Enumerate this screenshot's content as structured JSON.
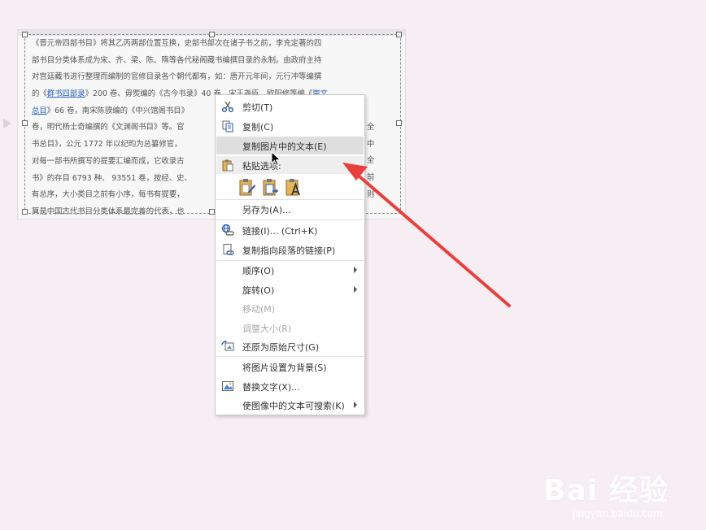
{
  "document": {
    "lines": [
      "《晋元帝四部书目》将其乙丙两部位置互换，史部书部次在诸子书之前，李充定著的四",
      "部书目分类体系成为宋、齐、梁、陈、隋等各代秘阁藏书编撰目录的永制。由政府主持",
      "对宫廷藏书进行整理而编制的官修目录各个朝代都有，如：唐开元年间，元行冲等编撰",
      [
        "的《",
        "群书四部录",
        "》200 卷、毋煚编的《古今书录》40 卷，宋王尧臣、欧阳修等编《",
        "崇文"
      ],
      [
        "",
        "总目",
        "》66 卷，南宋陈骙编的《中兴馆阁书目》"
      ],
      "卷，明代杨士奇编撰的《文渊阁书目》等。官",
      "书总目》，公元 1772 年以纪昀为总纂修官，",
      "对每一部书所撰写的提要汇编而成，它收录古",
      "书》的存目 6793 种、 93551 卷，按经、史、",
      "有总序，大小类目之前有小序，每书有提要，",
      "算是中国古代书目分类体系最完善的代表，也"
    ],
    "right_fragments": [
      "全",
      "中",
      "全",
      "前",
      "则"
    ]
  },
  "context_menu": {
    "items": [
      {
        "label": "剪切(T)",
        "icon": "scissors-icon",
        "disabled": false,
        "submenu": false
      },
      {
        "label": "复制(C)",
        "icon": "copy-icon",
        "disabled": false,
        "submenu": false
      },
      {
        "label": "复制图片中的文本(E)",
        "icon": "",
        "disabled": false,
        "submenu": false
      },
      {
        "label": "粘贴选项:",
        "icon": "paste-icon",
        "disabled": false,
        "submenu": false
      },
      {
        "label": "另存为(A)...",
        "icon": "",
        "disabled": false,
        "submenu": false
      },
      {
        "label": "链接(I)... (Ctrl+K)",
        "icon": "link-icon",
        "disabled": false,
        "submenu": false
      },
      {
        "label": "复制指向段落的链接(P)",
        "icon": "link-paragraph-icon",
        "disabled": false,
        "submenu": false
      },
      {
        "label": "顺序(O)",
        "icon": "",
        "disabled": false,
        "submenu": true
      },
      {
        "label": "旋转(O)",
        "icon": "",
        "disabled": false,
        "submenu": true
      },
      {
        "label": "移动(M)",
        "icon": "",
        "disabled": true,
        "submenu": false
      },
      {
        "label": "调整大小(R)",
        "icon": "",
        "disabled": true,
        "submenu": false
      },
      {
        "label": "还原为原始尺寸(G)",
        "icon": "reset-picture-icon",
        "disabled": false,
        "submenu": false
      },
      {
        "label": "将图片设置为背景(S)",
        "icon": "",
        "disabled": false,
        "submenu": false
      },
      {
        "label": "替换文字(X)...",
        "icon": "alt-text-icon",
        "disabled": false,
        "submenu": false
      },
      {
        "label": "使图像中的文本可搜索(K)",
        "icon": "",
        "disabled": false,
        "submenu": true
      }
    ],
    "paste_options": [
      "paste-keep-formatting-icon",
      "paste-picture-icon",
      "paste-text-only-icon"
    ]
  },
  "annotation": {
    "arrow_color": "#e8403d"
  },
  "watermark": {
    "logo": "Bai 经验",
    "url": "jingyan.baidu.com"
  }
}
